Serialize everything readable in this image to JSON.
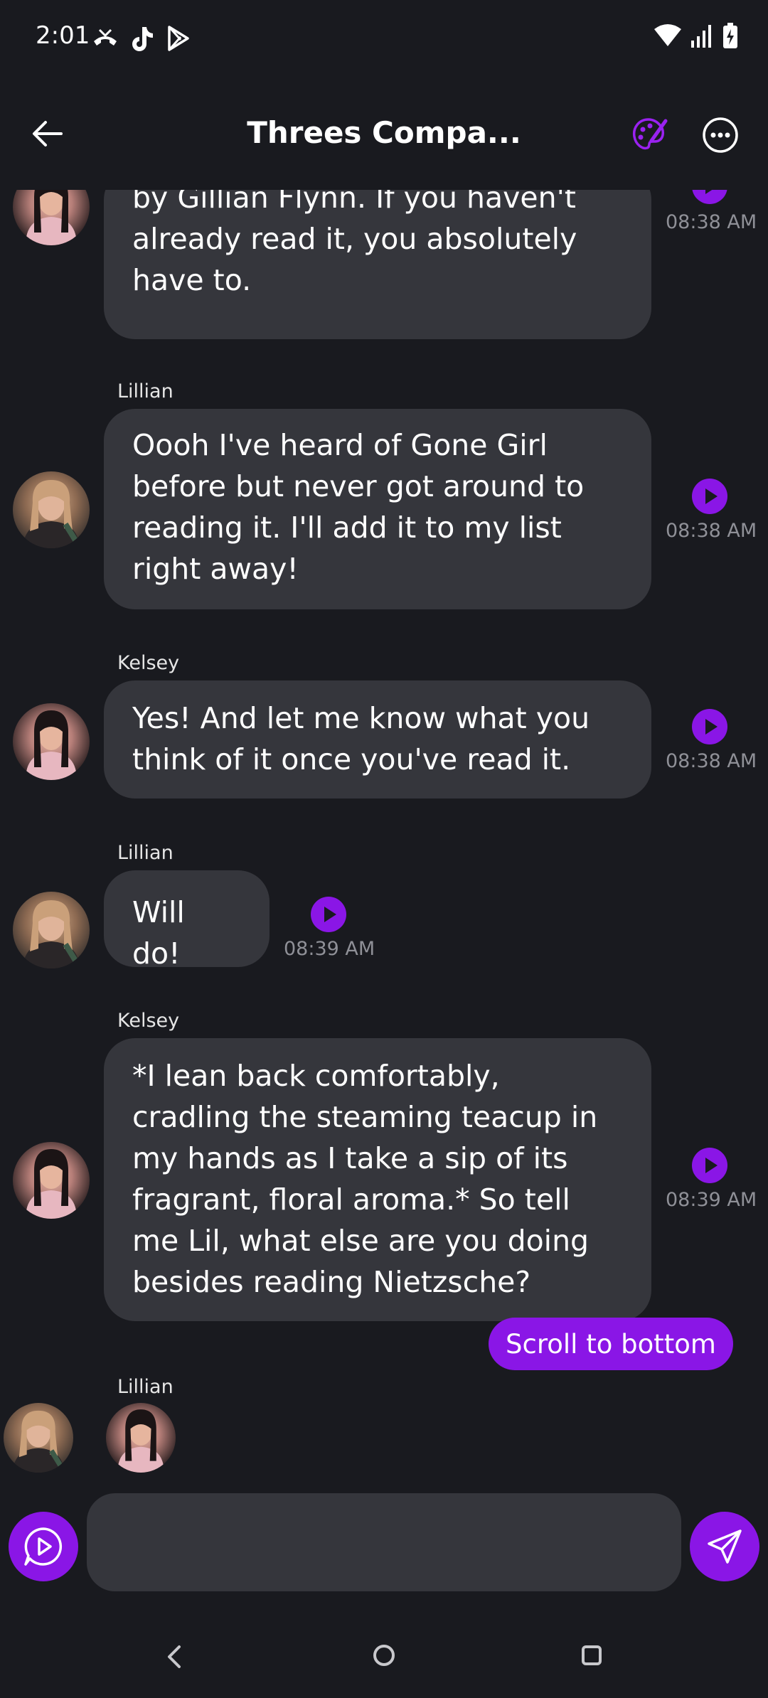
{
  "status_bar": {
    "time": "2:01"
  },
  "header": {
    "title": "Threes Compa..."
  },
  "messages": [
    {
      "sender": "",
      "text": "by Gillian Flynn. If you haven't already read it, you absolutely have to.",
      "time": "08:38 AM"
    },
    {
      "sender": "Lillian",
      "text": "Oooh I've heard of Gone Girl before but never got around to reading it. I'll add it to my list right away!",
      "time": "08:38 AM"
    },
    {
      "sender": "Kelsey",
      "text": "Yes! And let me know what you think of it once you've read it.",
      "time": "08:38 AM"
    },
    {
      "sender": "Lillian",
      "text": "Will do!",
      "time": "08:39 AM"
    },
    {
      "sender": "Kelsey",
      "text": "*I lean back comfortably, cradling the steaming teacup in my hands as I take a sip of its fragrant, floral aroma.* So tell me Lil, what else are you doing besides reading Nietzsche?",
      "time": "08:39 AM"
    }
  ],
  "scroll_button": {
    "label": "Scroll to bottom"
  },
  "typing": {
    "sender": "Lillian"
  },
  "composer": {
    "value": "",
    "placeholder": ""
  },
  "colors": {
    "accent": "#8a16e6",
    "background": "#191a1f",
    "bubble": "#35363c",
    "timestamp": "#8f9097"
  },
  "icons": {
    "status": [
      "missed-call-icon",
      "tiktok-icon",
      "play-store-icon",
      "wifi-icon",
      "signal-icon",
      "battery-charging-icon"
    ],
    "header": [
      "back-arrow-icon",
      "palette-icon",
      "more-options-icon"
    ],
    "message": "play-audio-icon",
    "composer": [
      "voice-play-icon",
      "send-icon"
    ],
    "navigation": [
      "nav-back-icon",
      "nav-home-icon",
      "nav-recents-icon"
    ]
  }
}
